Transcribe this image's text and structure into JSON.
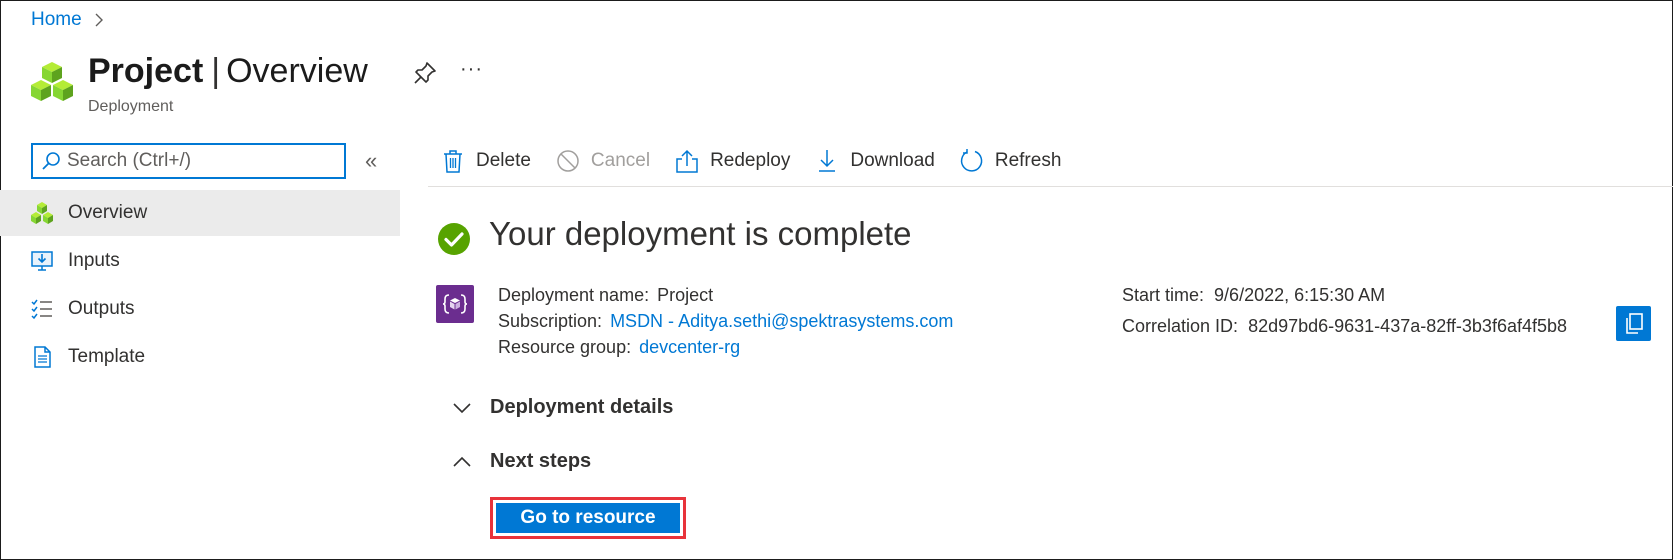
{
  "breadcrumb": {
    "home": "Home"
  },
  "header": {
    "title_main": "Project",
    "title_separator": "|",
    "title_sub": "Overview",
    "subtitle": "Deployment",
    "more": "···"
  },
  "search": {
    "placeholder": "Search (Ctrl+/)",
    "collapse": "«"
  },
  "nav": {
    "items": [
      {
        "label": "Overview",
        "icon": "cubes-icon",
        "active": true
      },
      {
        "label": "Inputs",
        "icon": "monitor-download-icon"
      },
      {
        "label": "Outputs",
        "icon": "checklist-icon"
      },
      {
        "label": "Template",
        "icon": "document-icon"
      }
    ]
  },
  "toolbar": {
    "delete": "Delete",
    "cancel": "Cancel",
    "redeploy": "Redeploy",
    "download": "Download",
    "refresh": "Refresh"
  },
  "status": {
    "title": "Your deployment is complete"
  },
  "details": {
    "deployment_name_label": "Deployment name:",
    "deployment_name": "Project",
    "subscription_label": "Subscription:",
    "subscription": "MSDN - Aditya.sethi@spektrasystems.com",
    "resource_group_label": "Resource group:",
    "resource_group": "devcenter-rg",
    "start_time_label": "Start time:",
    "start_time": "9/6/2022, 6:15:30 AM",
    "correlation_label": "Correlation ID:",
    "correlation_id": "82d97bd6-9631-437a-82ff-3b3f6af4f5b8"
  },
  "sections": {
    "deployment_details": "Deployment details",
    "next_steps": "Next steps"
  },
  "actions": {
    "go_to_resource": "Go to resource"
  },
  "colors": {
    "accent": "#0078d4",
    "success": "#57a300",
    "highlight": "#e8333b",
    "resource_icon_bg": "#6b2d8f"
  }
}
